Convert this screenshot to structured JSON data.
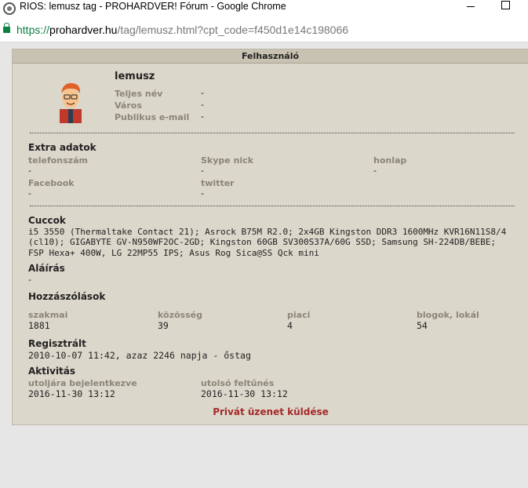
{
  "window": {
    "title": "RIOS: lemusz tag - PROHARDVER! Fórum - Google Chrome"
  },
  "address": {
    "scheme": "https://",
    "host": "prohardver.hu",
    "path": "/tag/lemusz.html?cpt_code=f450d1e14c198066"
  },
  "panel": {
    "header": "Felhasználó",
    "username": "lemusz",
    "basic": [
      {
        "label": "Teljes név",
        "value": "-"
      },
      {
        "label": "Város",
        "value": "-"
      },
      {
        "label": "Publikus e-mail",
        "value": "-"
      }
    ],
    "extra": {
      "title": "Extra adatok",
      "fields": [
        {
          "label": "telefonszám",
          "value": "-"
        },
        {
          "label": "Skype nick",
          "value": "-"
        },
        {
          "label": "honlap",
          "value": "-"
        },
        {
          "label": "Facebook",
          "value": "-"
        },
        {
          "label": "twitter",
          "value": "-"
        }
      ]
    },
    "cuccok": {
      "title": "Cuccok",
      "text": "i5 3550 (Thermaltake Contact 21); Asrock B75M R2.0; 2x4GB Kingston DDR3 1600MHz KVR16N11S8/4 (cl10); GIGABYTE GV-N950WF2OC-2GD; Kingston 60GB SV300S37A/60G SSD; Samsung SH-224DB/BEBE; FSP Hexa+ 400W, LG 22MP55 IPS; Asus Rog Sica@SS Qck mini"
    },
    "signature": {
      "title": "Aláírás",
      "value": "-"
    },
    "posts": {
      "title": "Hozzászólások",
      "columns": [
        {
          "label": "szakmai",
          "value": "1881"
        },
        {
          "label": "közösség",
          "value": "39"
        },
        {
          "label": "piaci",
          "value": "4"
        },
        {
          "label": "blogok, lokál",
          "value": "54"
        }
      ]
    },
    "registered": {
      "title": "Regisztrált",
      "value": "2010-10-07 11:42, azaz 2246 napja - őstag"
    },
    "activity": {
      "title": "Aktivitás",
      "last_login_label": "utoljára bejelentkezve",
      "last_login_value": "2016-11-30 13:12",
      "last_seen_label": "utolsó feltűnés",
      "last_seen_value": "2016-11-30 13:12"
    },
    "send_message": "Privát üzenet küldése"
  },
  "colors": {
    "panel_bg": "#dcd7cb",
    "header_bg": "#c8c2b2",
    "label": "#8a8578",
    "link": "#a52a2a",
    "secure": "#0b8043"
  }
}
